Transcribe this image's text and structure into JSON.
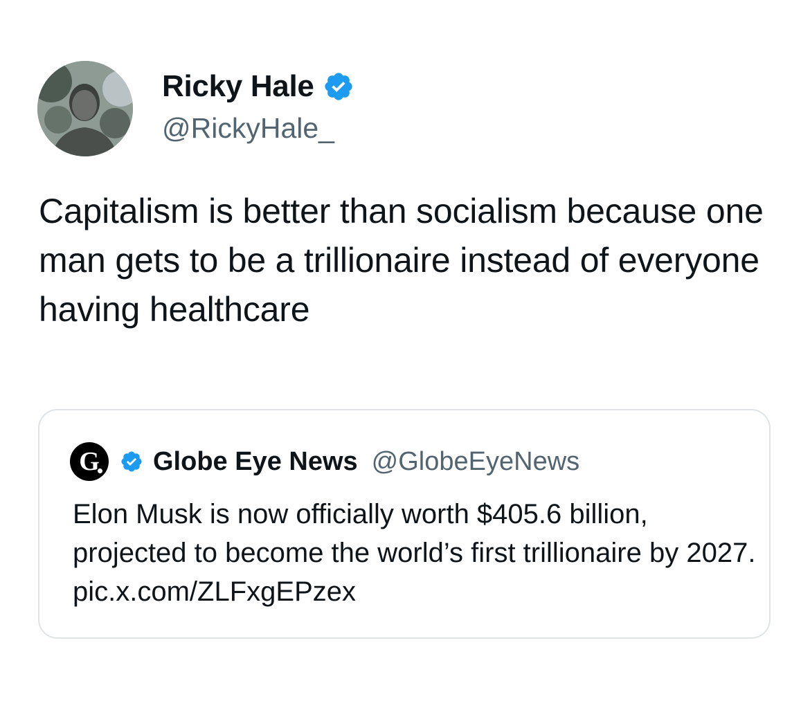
{
  "tweet": {
    "author": {
      "display_name": "Ricky Hale",
      "handle": "@RickyHale_",
      "verified_icon": "verified-badge-icon",
      "avatar": "profile-photo"
    },
    "text": "Capitalism is better than socialism because one man gets to be a trillionaire instead of everyone having healthcare"
  },
  "quoted_tweet": {
    "author": {
      "avatar_letter": "G",
      "verified_icon": "verified-badge-icon",
      "display_name": "Globe Eye News",
      "handle": "@GlobeEyeNews"
    },
    "text": "Elon Musk is now officially worth $405.6 billion, projected to become the world’s first trillionaire by 2027. pic.x.com/ZLFxgEPzex"
  },
  "colors": {
    "verified_blue": "#1d9bf0",
    "text_primary": "#0f1419",
    "text_secondary": "#536471",
    "card_border": "#dfe3e6"
  }
}
